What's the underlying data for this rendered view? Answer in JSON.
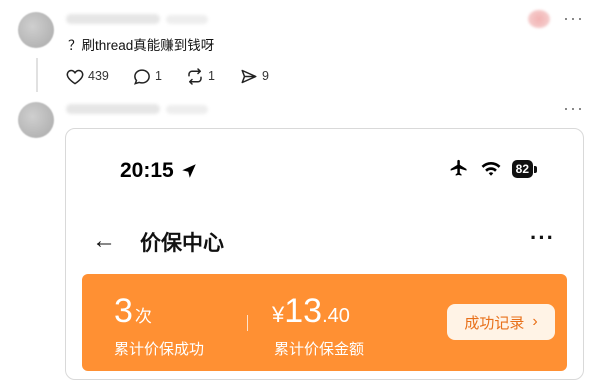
{
  "post": {
    "text": "？刷thread真能赚到钱呀",
    "likes": "439",
    "comments": "1",
    "reposts": "1",
    "shares": "9"
  },
  "more_label": "···",
  "screenshot": {
    "status_time": "20:15",
    "battery": "82",
    "nav_back": "←",
    "nav_title": "价保中心",
    "nav_more": "···",
    "stats": {
      "count_num": "3",
      "count_unit": "次",
      "count_label": "累计价保成功",
      "amount_symbol": "¥",
      "amount_int": "13",
      "amount_dec": ".40",
      "amount_label": "累计价保金额"
    },
    "records_button": "成功记录",
    "records_chevron": "›",
    "banner_color": "#ff9033"
  }
}
